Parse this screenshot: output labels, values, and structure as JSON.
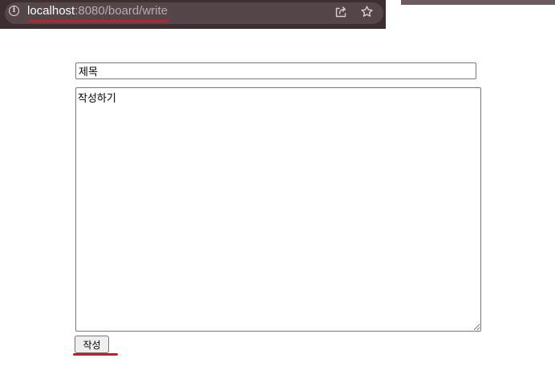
{
  "browser": {
    "url_host": "localhost",
    "url_path": ":8080/board/write",
    "icons": {
      "site_info": "info-icon",
      "share": "share-icon",
      "bookmark": "star-icon"
    },
    "info_glyph": "i"
  },
  "form": {
    "title_value": "제목",
    "content_value": "작성하기",
    "submit_label": "작성"
  },
  "colors": {
    "bar_background": "#3d2e32",
    "annotation_red": "#e0131b"
  }
}
